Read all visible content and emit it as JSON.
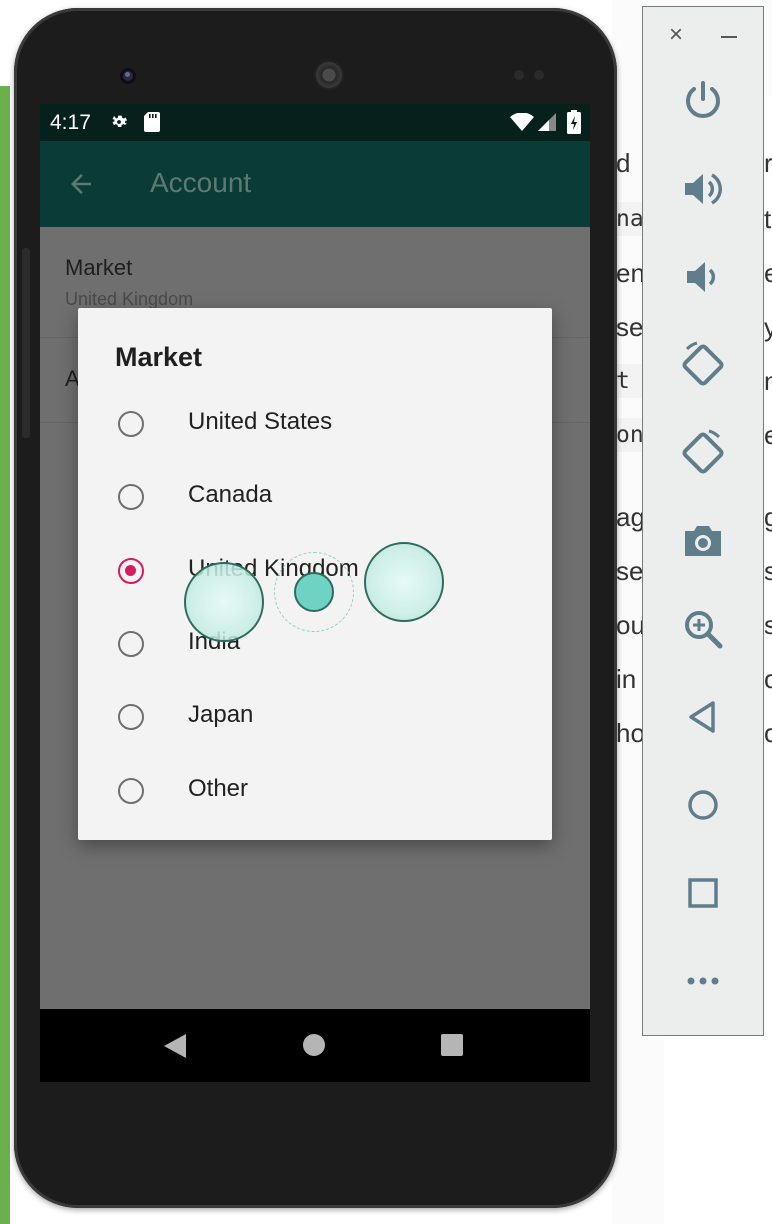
{
  "colors": {
    "appbar": "#0b3b37",
    "statusbar": "#06201c",
    "accent_radio": "#d81b60",
    "scrim_content": "#6f6f6f",
    "dialog_bg": "#f3f3f3",
    "toolbar_bg": "#eceeee"
  },
  "statusbar": {
    "time": "4:17",
    "icons": [
      "gear-icon",
      "sd-card-icon",
      "wifi-icon",
      "signal-icon",
      "battery-icon"
    ]
  },
  "appbar": {
    "title": "Account",
    "back_icon": "arrow-back-icon"
  },
  "preferences": [
    {
      "title": "Market",
      "summary": "United Kingdom"
    },
    {
      "title": "A",
      "summary": ""
    }
  ],
  "dialog": {
    "title": "Market",
    "options": [
      {
        "label": "United States",
        "checked": false
      },
      {
        "label": "Canada",
        "checked": false
      },
      {
        "label": "United Kingdom",
        "checked": true
      },
      {
        "label": "India",
        "checked": false
      },
      {
        "label": "Japan",
        "checked": false
      },
      {
        "label": "Other",
        "checked": false
      }
    ]
  },
  "navbar": {
    "buttons": [
      "nav-back-icon",
      "nav-home-icon",
      "nav-recents-icon"
    ]
  },
  "emulator_toolbar": {
    "window_controls": [
      "close-icon",
      "minimize-icon"
    ],
    "close_glyph": "×",
    "buttons": [
      "power-icon",
      "volume-up-icon",
      "volume-down-icon",
      "rotate-left-icon",
      "rotate-right-icon",
      "camera-icon",
      "zoom-icon",
      "back-icon",
      "home-icon",
      "overview-icon",
      "more-icon"
    ]
  },
  "background_fragments": {
    "left": [
      "d",
      "na",
      "en",
      "se",
      "t n",
      "on",
      "ag",
      "se",
      "ou",
      "in",
      "ho"
    ],
    "right": [
      "re",
      "t",
      "ec",
      "y",
      "ne",
      "e",
      "g",
      "st",
      "s",
      "o",
      "ov"
    ]
  }
}
